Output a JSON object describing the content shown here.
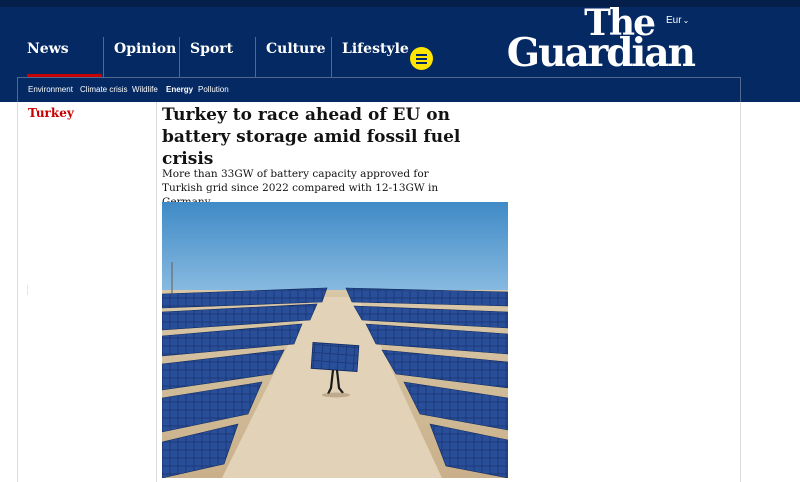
{
  "masthead": {
    "currency": "Eur",
    "logo_line1": "The",
    "logo_line2": "Guardian",
    "menu_icon": "menu-icon"
  },
  "pillars": [
    {
      "label": "News",
      "active": true
    },
    {
      "label": "Opinion",
      "active": false
    },
    {
      "label": "Sport",
      "active": false
    },
    {
      "label": "Culture",
      "active": false
    },
    {
      "label": "Lifestyle",
      "active": false
    }
  ],
  "subnav": [
    {
      "label": "Environment",
      "current": false
    },
    {
      "label": "Climate crisis",
      "current": false
    },
    {
      "label": "Wildlife",
      "current": false
    },
    {
      "label": "Energy",
      "current": true
    },
    {
      "label": "Pollution",
      "current": false
    }
  ],
  "article": {
    "section": "Turkey",
    "headline": "Turkey to race ahead of EU on battery storage amid fossil fuel crisis",
    "standfirst": "More than 33GW of battery capacity approved for Turkish grid since 2022 compared with 12-13GW in Germany"
  },
  "colors": {
    "brand_blue": "#052962",
    "section_red": "#c70000",
    "menu_yellow": "#ffe500"
  }
}
